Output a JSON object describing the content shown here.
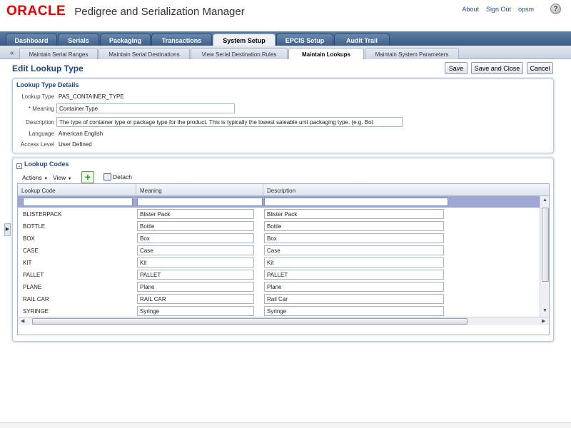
{
  "header": {
    "logo": "ORACLE",
    "app_title": "Pedigree and Serialization Manager",
    "links": [
      "About",
      "Sign Out"
    ],
    "user": "opsm",
    "help_icon": "help-icon"
  },
  "main_tabs": [
    {
      "label": "Dashboard",
      "active": false
    },
    {
      "label": "Serials",
      "active": false
    },
    {
      "label": "Packaging",
      "active": false
    },
    {
      "label": "Transactions",
      "active": false
    },
    {
      "label": "System Setup",
      "active": true
    },
    {
      "label": "EPCIS Setup",
      "active": false
    },
    {
      "label": "Audit Trail",
      "active": false
    }
  ],
  "sub_tabs": [
    {
      "label": "Maintain Serial Ranges",
      "active": false
    },
    {
      "label": "Maintain Serial Destinations",
      "active": false
    },
    {
      "label": "View Serial Destination Rules",
      "active": false
    },
    {
      "label": "Maintain Lookups",
      "active": true
    },
    {
      "label": "Maintain System Parameters",
      "active": false
    }
  ],
  "sub_tabs_collapse": "«",
  "page": {
    "title": "Edit Lookup Type",
    "buttons": {
      "save": "Save",
      "save_close": "Save and Close",
      "cancel": "Cancel"
    }
  },
  "details": {
    "title": "Lookup Type Details",
    "lookup_type_label": "Lookup Type",
    "lookup_type_value": "PAS_CONTAINER_TYPE",
    "meaning_label": "* Meaning",
    "meaning_value": "Container Type",
    "description_label": "Description",
    "description_value": "The type of container type or package type for the product.  This is typically the lowest saleable unit packaging type.  (e.g. Bot",
    "language_label": "Language",
    "language_value": "American English",
    "access_label": "Access Level",
    "access_value": "User Defined"
  },
  "codes": {
    "title": "Lookup Codes",
    "actions": "Actions",
    "view": "View",
    "detach": "Detach",
    "columns": [
      "Lookup Code",
      "Meaning",
      "Description"
    ],
    "rows": [
      {
        "code": "BLISTERPACK",
        "meaning": "Blister Pack",
        "description": "Blister Pack"
      },
      {
        "code": "BOTTLE",
        "meaning": "Bottle",
        "description": "Bottle"
      },
      {
        "code": "BOX",
        "meaning": "Box",
        "description": "Box"
      },
      {
        "code": "CASE",
        "meaning": "Case",
        "description": "Case"
      },
      {
        "code": "KIT",
        "meaning": "Kit",
        "description": "Kit"
      },
      {
        "code": "PALLET",
        "meaning": "PALLET",
        "description": "PALLET"
      },
      {
        "code": "PLANE",
        "meaning": "Plane",
        "description": "Plane"
      },
      {
        "code": "RAIL CAR",
        "meaning": "RAIL CAR",
        "description": "Rail Car"
      },
      {
        "code": "SYRINGE",
        "meaning": "Syringe",
        "description": "Syringe"
      }
    ]
  }
}
